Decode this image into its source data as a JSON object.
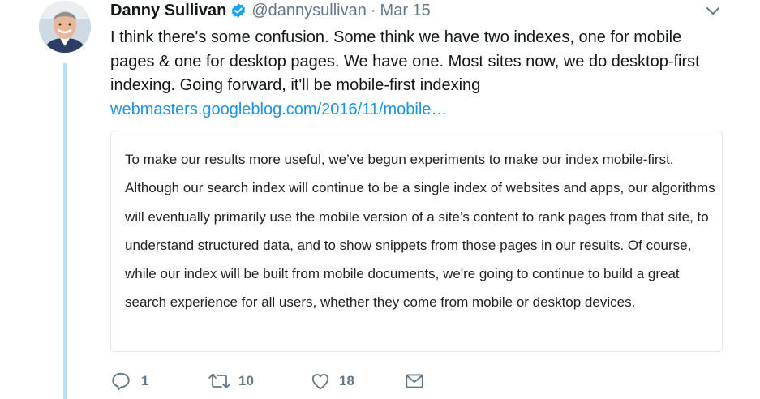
{
  "tweet": {
    "author_name": "Danny Sullivan",
    "handle": "@dannysullivan",
    "separator": "·",
    "date": "Mar 15",
    "text": "I think there's some confusion. Some think we have two indexes, one for mobile pages & one for desktop pages. We have one. Most sites now, we do desktop-first indexing. Going forward, it'll be mobile-first indexing",
    "link": "webmasters.googleblog.com/2016/11/mobile…",
    "quote_text": "To make our results more useful, we’ve begun experiments to make our index mobile-first. Although our search index will continue to be a single index of websites and apps, our algorithms will eventually primarily use the mobile version of a site’s content to rank pages from that site, to understand structured data, and to show snippets from those pages in our results. Of course, while our index will be built from mobile documents, we're going to continue to build a great search experience for all users, whether they come from mobile or desktop devices."
  },
  "actions": {
    "reply_count": "1",
    "retweet_count": "10",
    "like_count": "18"
  },
  "colors": {
    "accent": "#1b95e0",
    "muted": "#657786",
    "thread_line": "#b3dffb",
    "verified": "#1da1f2"
  },
  "icons": [
    "verified-badge-icon",
    "chevron-down-icon",
    "reply-icon",
    "retweet-icon",
    "like-icon",
    "mail-icon"
  ]
}
